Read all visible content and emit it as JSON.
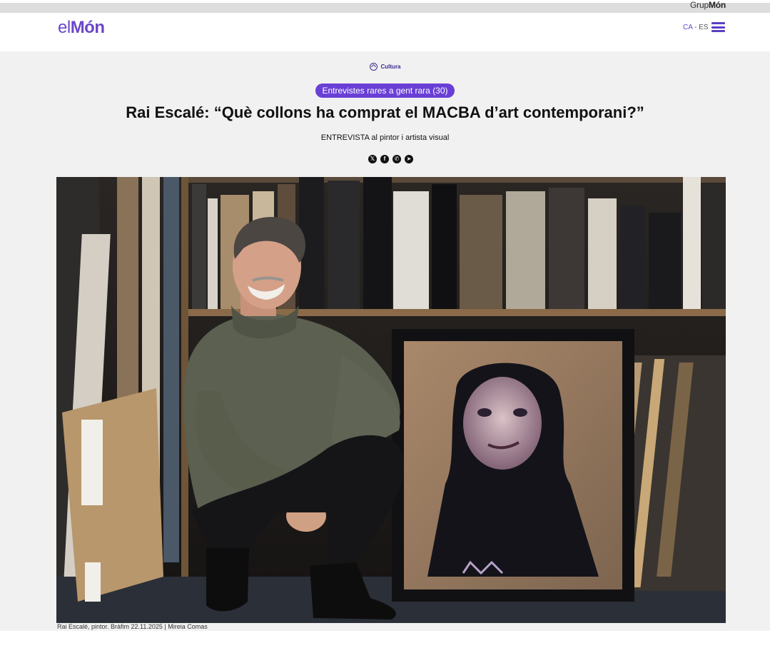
{
  "brand": {
    "group_prefix": "Grup",
    "group_suffix": "Món",
    "logo_part1": "el",
    "logo_part2": "Món",
    "accent": "#6b46c8"
  },
  "lang": {
    "ca": "CA",
    "sep": " - ",
    "es": "ES"
  },
  "icons": {
    "menu": "hamburger-icon",
    "section": "home-icon",
    "share": [
      "x-icon",
      "facebook-icon",
      "whatsapp-icon",
      "telegram-icon"
    ]
  },
  "article": {
    "section": "Cultura",
    "series": "Entrevistes rares a gent rara (30)",
    "title": "Rai Escalé: “Què collons ha comprat el MACBA d’art contemporani?”",
    "subtitle": "ENTREVISTA al pintor i artista visual",
    "caption": "Rai Escalé, pintor. Bràfim 22.11.2025 | Mireia Comas"
  }
}
